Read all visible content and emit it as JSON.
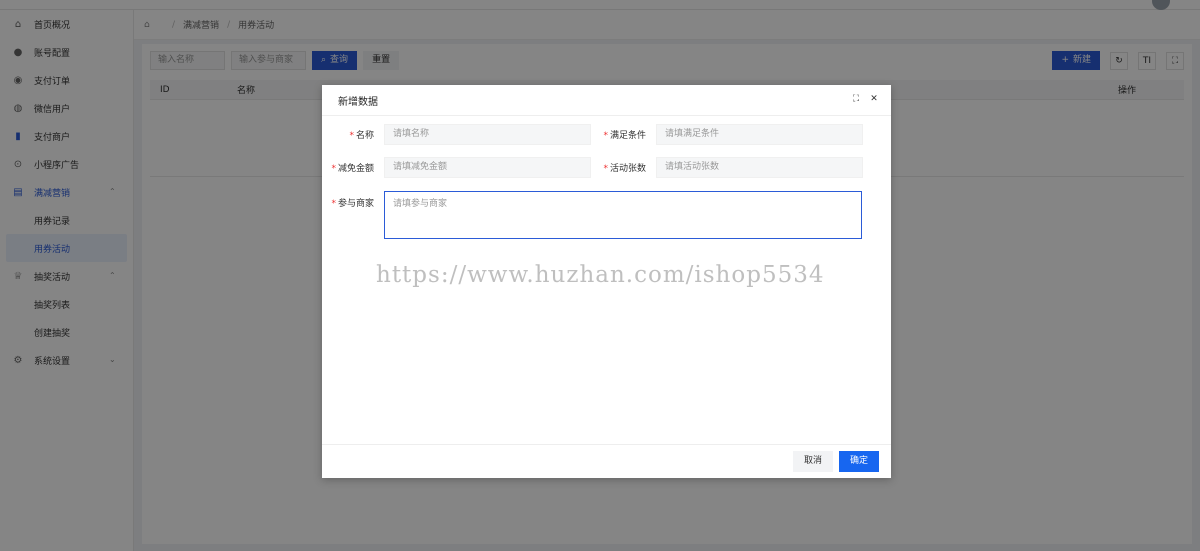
{
  "sidebar": {
    "items": [
      {
        "label": "首页概况",
        "icon": "dashboard-icon"
      },
      {
        "label": "账号配置",
        "icon": "account-icon"
      },
      {
        "label": "支付订单",
        "icon": "order-icon"
      },
      {
        "label": "微信用户",
        "icon": "wechat-icon"
      },
      {
        "label": "支付商户",
        "icon": "merchant-icon"
      },
      {
        "label": "小程序广告",
        "icon": "miniapp-icon"
      },
      {
        "label": "满减营销",
        "icon": "marketing-icon"
      },
      {
        "label": "用券记录"
      },
      {
        "label": "用券活动"
      },
      {
        "label": "抽奖活动",
        "icon": "trophy-icon"
      },
      {
        "label": "抽奖列表"
      },
      {
        "label": "创建抽奖"
      },
      {
        "label": "系统设置",
        "icon": "settings-icon"
      }
    ]
  },
  "breadcrumb": {
    "items": [
      "满减营销",
      "用券活动"
    ]
  },
  "search": {
    "name_placeholder": "输入名称",
    "merchant_placeholder": "输入参与商家",
    "query_label": "查询",
    "reset_label": "重置"
  },
  "toolbar": {
    "new_label": "新建",
    "density_label": "TI"
  },
  "table": {
    "headers": [
      "ID",
      "名称",
      "操作"
    ]
  },
  "modal": {
    "title": "新增数据",
    "fields": {
      "name_label": "名称",
      "name_placeholder": "请填名称",
      "condition_label": "满足条件",
      "condition_placeholder": "请填满足条件",
      "discount_label": "减免金额",
      "discount_placeholder": "请填减免金额",
      "count_label": "活动张数",
      "count_placeholder": "请填活动张数",
      "merchant_label": "参与商家",
      "merchant_placeholder": "请填参与商家"
    },
    "cancel_label": "取消",
    "confirm_label": "确定"
  },
  "watermark": "https://www.huzhan.com/ishop5534",
  "colors": {
    "accent": "#2b5bd7",
    "primary_button": "#1766f0",
    "required": "#e33333"
  }
}
